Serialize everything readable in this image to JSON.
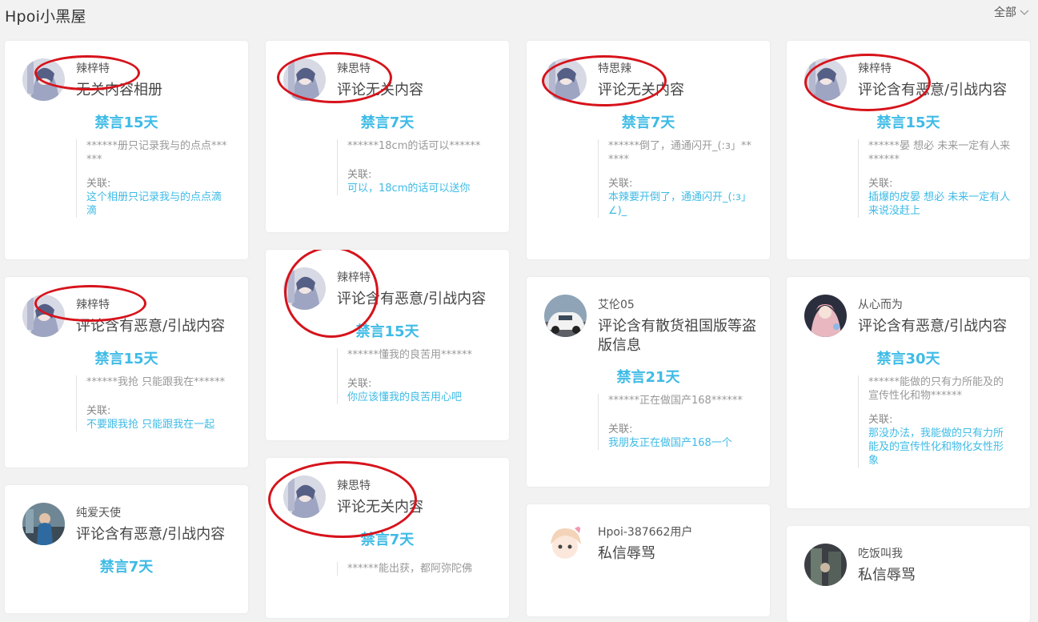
{
  "header": {
    "title": "Hpoi小黑屋",
    "filter": "全部"
  },
  "labels": {
    "relation": "关联:"
  },
  "cards": [
    {
      "user": "辣梓特",
      "reason": "无关内容相册",
      "ban": "禁言15天",
      "quote": "******册只记录我与的点点******",
      "relation": "这个相册只记录我与的点点滴滴",
      "avatar": "anime-avatar"
    },
    {
      "user": "辣梓特",
      "reason": "评论含有恶意/引战内容",
      "ban": "禁言15天",
      "quote": "******我抢 只能跟我在******",
      "relation": "不要跟我抢 只能跟我在一起",
      "avatar": "anime-avatar"
    },
    {
      "user": "纯爱天使",
      "reason": "评论含有恶意/引战内容",
      "ban": "禁言7天",
      "avatar": "photo-avatar"
    },
    {
      "user": "辣思特",
      "reason": "评论无关内容",
      "ban": "禁言7天",
      "quote": "******18cm的话可以******",
      "relation": "可以，18cm的话可以送你",
      "avatar": "anime-avatar"
    },
    {
      "user": "辣梓特",
      "reason": "评论含有恶意/引战内容",
      "ban": "禁言15天",
      "quote": "******懂我的良苦用******",
      "relation": "你应该懂我的良苦用心吧",
      "avatar": "anime-avatar"
    },
    {
      "user": "辣思特",
      "reason": "评论无关内容",
      "ban": "禁言7天",
      "quote": "******能出获，都阿弥陀佛",
      "avatar": "anime-avatar"
    },
    {
      "user": "特思辣",
      "reason": "评论无关内容",
      "ban": "禁言7天",
      "quote": "******倒了，通通闪开_(:з」******",
      "relation": "本辣要开倒了，通通闪开_(:з」∠)_",
      "avatar": "anime-avatar"
    },
    {
      "user": "艾伦05",
      "reason": "评论含有散货祖国版等盗版信息",
      "ban": "禁言21天",
      "quote": "******正在做国产168******",
      "relation": "我朋友正在做国产168一个",
      "avatar": "car-avatar"
    },
    {
      "user": "Hpoi-387662用户",
      "reason": "私信辱骂",
      "avatar": "chibi-avatar"
    },
    {
      "user": "辣梓特",
      "reason": "评论含有恶意/引战内容",
      "ban": "禁言15天",
      "quote": "******晏 想必 未来一定有人来******",
      "relation": "插爆的皮晏 想必 未来一定有人来说没赶上",
      "avatar": "anime-avatar"
    },
    {
      "user": "从心而为",
      "reason": "评论含有恶意/引战内容",
      "ban": "禁言30天",
      "quote": "******能做的只有力所能及的宣传性化和物******",
      "relation": "那没办法，我能做的只有力所能及的宣传性化和物化女性形象",
      "avatar": "girl-avatar"
    },
    {
      "user": "吃饭叫我",
      "reason": "私信辱骂",
      "avatar": "dark-avatar"
    }
  ]
}
